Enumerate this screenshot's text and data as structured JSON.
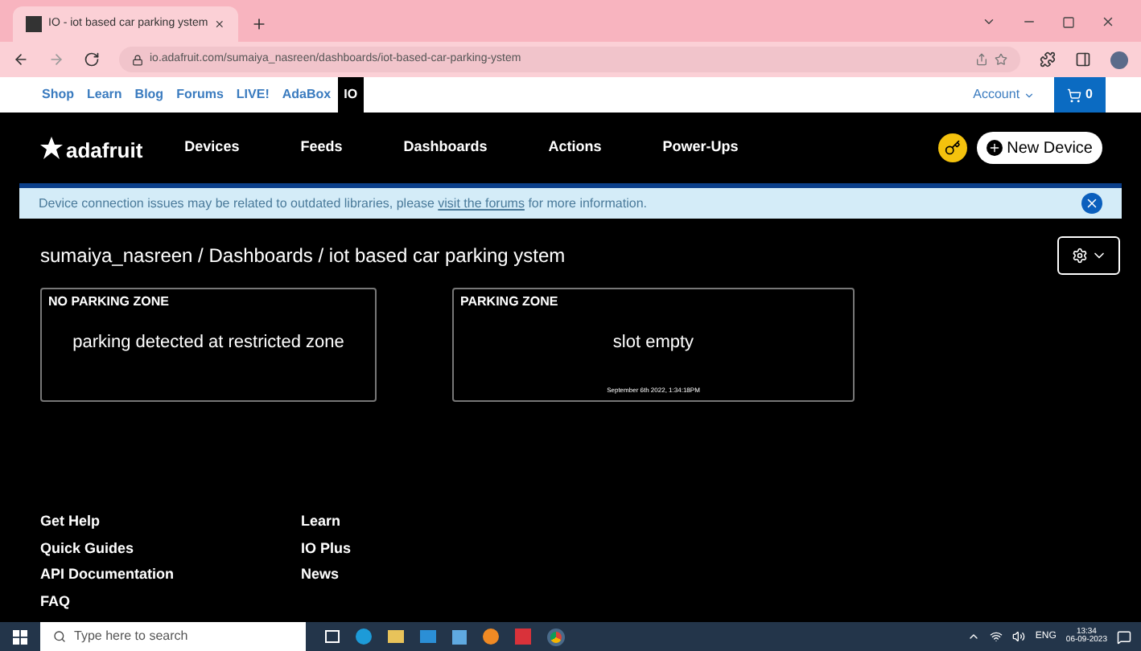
{
  "browser": {
    "tab_title": "IO - iot based car parking ystem",
    "url": "io.adafruit.com/sumaiya_nasreen/dashboards/iot-based-car-parking-ystem"
  },
  "site_nav": {
    "items": [
      {
        "label": "Shop",
        "selected": false
      },
      {
        "label": "Learn",
        "selected": false
      },
      {
        "label": "Blog",
        "selected": false
      },
      {
        "label": "Forums",
        "selected": false
      },
      {
        "label": "LIVE!",
        "selected": false
      },
      {
        "label": "AdaBox",
        "selected": false
      },
      {
        "label": "IO",
        "selected": true
      }
    ],
    "account": "Account",
    "cart_count": "0"
  },
  "header": {
    "logo": "adafruit",
    "nav": [
      "Devices",
      "Feeds",
      "Dashboards",
      "Actions",
      "Power-Ups"
    ],
    "new_device": "New Device"
  },
  "banner": {
    "text_before": "Device connection issues may be related to outdated libraries, please",
    "link": "visit the forums",
    "text_after": "for more information."
  },
  "breadcrumb": "sumaiya_nasreen / Dashboards / iot based car parking ystem",
  "blocks": [
    {
      "title": "NO PARKING ZONE",
      "value": "parking detected at restricted zone"
    },
    {
      "title": "PARKING ZONE",
      "value": "slot empty",
      "timestamp": "September 6th 2022, 1:34:18PM"
    }
  ],
  "footer": {
    "columns": [
      [
        "Get Help",
        "Quick Guides",
        "API Documentation",
        "FAQ"
      ],
      [
        "Learn",
        "IO Plus",
        "News"
      ]
    ]
  },
  "taskbar": {
    "search_placeholder": "Type here to search",
    "language": "ENG",
    "time": "13:34",
    "date": "06-09-2023"
  }
}
